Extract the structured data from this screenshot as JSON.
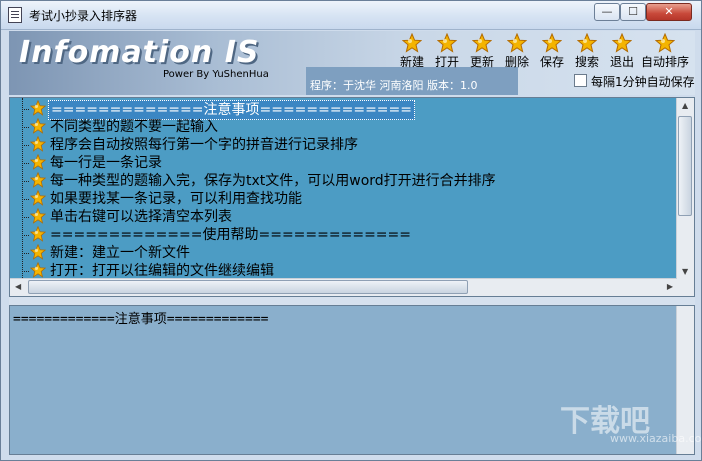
{
  "window": {
    "title": "考试小抄录入排序器",
    "minimize_glyph": "—",
    "maximize_glyph": "☐",
    "close_glyph": "✕"
  },
  "header": {
    "logo": "Infomation IS",
    "power": "Power By YuShenHua",
    "info": "程序：于沈华   河南洛阳   版本：1.0"
  },
  "toolbar": {
    "buttons": [
      {
        "label": "新建",
        "icon": "star-icon"
      },
      {
        "label": "打开",
        "icon": "star-icon"
      },
      {
        "label": "更新",
        "icon": "star-icon"
      },
      {
        "label": "删除",
        "icon": "star-icon"
      },
      {
        "label": "保存",
        "icon": "star-icon"
      },
      {
        "label": "搜索",
        "icon": "star-icon"
      },
      {
        "label": "退出",
        "icon": "star-icon"
      },
      {
        "label": "自动排序",
        "icon": "star-icon"
      }
    ],
    "autosave_label": "每隔1分钟自动保存",
    "autosave_checked": false
  },
  "tree": {
    "items": [
      "=============注意事项=============",
      "不同类型的题不要一起输入",
      "程序会自动按照每行第一个字的拼音进行记录排序",
      "每一行是一条记录",
      "每一种类型的题输入完，保存为txt文件，可以用word打开进行合并排序",
      "如果要找某一条记录，可以利用查找功能",
      "单击右键可以选择清空本列表",
      "=============使用帮助=============",
      "新建：建立一个新文件",
      "打开：打开以往编辑的文件继续编辑"
    ],
    "selected_index": 0
  },
  "editor": {
    "text": "=============注意事项============="
  },
  "watermark": {
    "text": "下载吧",
    "sub": "www.xiazaiba.com"
  },
  "colors": {
    "tree_bg": "#4c9cc4",
    "editor_bg": "#8aafcc",
    "star": "#f4b400"
  }
}
